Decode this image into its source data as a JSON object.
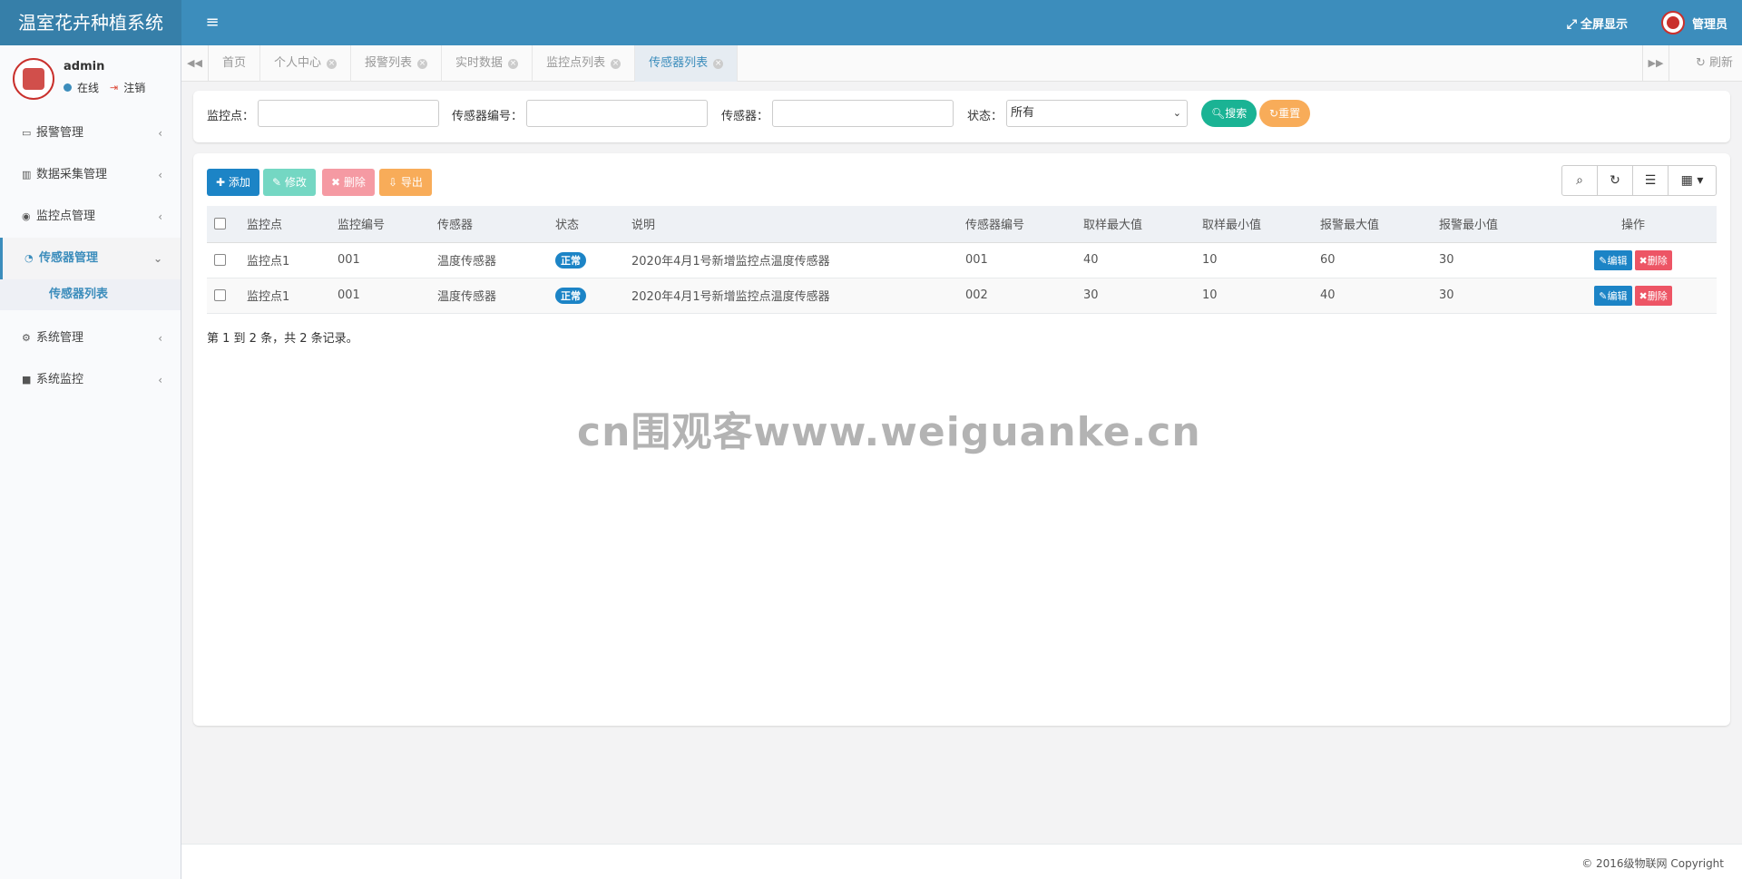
{
  "header": {
    "app_title": "温室花卉种植系统",
    "toggle_icon": "≡",
    "fullscreen_label": "全屏显示",
    "admin_label": "管理员"
  },
  "user": {
    "name": "admin",
    "online_label": "在线",
    "logout_label": "注销"
  },
  "sidebar": {
    "items": [
      {
        "label": "报警管理",
        "icon": "monitor-icon"
      },
      {
        "label": "数据采集管理",
        "icon": "bar-chart-icon"
      },
      {
        "label": "监控点管理",
        "icon": "eye-icon"
      },
      {
        "label": "传感器管理",
        "icon": "dashboard-icon",
        "active": true
      },
      {
        "label": "系统管理",
        "icon": "gear-icon"
      },
      {
        "label": "系统监控",
        "icon": "video-icon"
      }
    ],
    "submenu_label": "传感器列表"
  },
  "tabs": [
    {
      "label": "首页"
    },
    {
      "label": "个人中心"
    },
    {
      "label": "报警列表"
    },
    {
      "label": "实时数据"
    },
    {
      "label": "监控点列表"
    },
    {
      "label": "传感器列表",
      "active": true
    }
  ],
  "refresh_label": "刷新",
  "search": {
    "monitor_point_label": "监控点：",
    "sensor_code_label": "传感器编号：",
    "sensor_label": "传感器：",
    "status_label": "状态：",
    "status_value": "所有",
    "search_button": "搜索",
    "reset_button": "重置"
  },
  "toolbar": {
    "add_label": "添加",
    "edit_label": "修改",
    "delete_label": "删除",
    "export_label": "导出"
  },
  "table": {
    "columns": [
      "监控点",
      "监控编号",
      "传感器",
      "状态",
      "说明",
      "传感器编号",
      "取样最大值",
      "取样最小值",
      "报警最大值",
      "报警最小值",
      "操作"
    ],
    "rows": [
      {
        "monitor_point": "监控点1",
        "monitor_code": "001",
        "sensor": "温度传感器",
        "status": "正常",
        "description": "2020年4月1号新增监控点温度传感器",
        "sensor_code": "001",
        "sample_max": "40",
        "sample_min": "10",
        "alarm_max": "60",
        "alarm_min": "30",
        "edit_label": "编辑",
        "delete_label": "删除"
      },
      {
        "monitor_point": "监控点1",
        "monitor_code": "001",
        "sensor": "温度传感器",
        "status": "正常",
        "description": "2020年4月1号新增监控点温度传感器",
        "sensor_code": "002",
        "sample_max": "30",
        "sample_min": "10",
        "alarm_max": "40",
        "alarm_min": "30",
        "edit_label": "编辑",
        "delete_label": "删除"
      }
    ]
  },
  "pager_info": "第 1 到 2 条，共 2 条记录。",
  "watermark": "cn围观客www.weiguanke.cn",
  "footer": {
    "copyright": "© 2016级物联网 Copyright"
  },
  "colors": {
    "header_bg": "#3c8dbc",
    "logo_bg": "#367fa9",
    "primary": "#1c84c6",
    "success": "#1ab394",
    "warning": "#f8ac59",
    "danger": "#ed5565"
  }
}
